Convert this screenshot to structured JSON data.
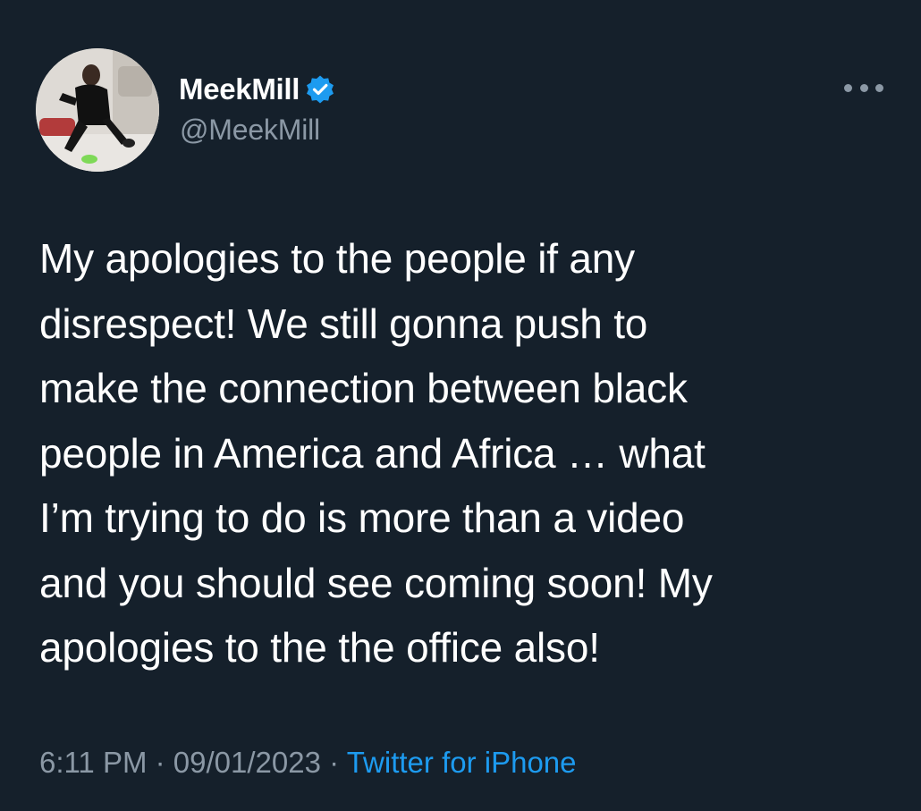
{
  "tweet": {
    "author": {
      "display_name": "MeekMill",
      "handle": "@MeekMill",
      "verified": true,
      "verified_icon": "verified-badge-icon"
    },
    "more_icon": "more-options-icon",
    "text_lines": [
      "My apologies to the people if any",
      "disrespect! We still gonna push to",
      "make the connection between black",
      "people in America and Africa … what",
      "I’m trying to do is more than a video",
      "and you should see coming soon! My",
      "apologies to the the office also!"
    ],
    "time": "6:11 PM",
    "separator": "·",
    "date": "09/01/2023",
    "source": "Twitter for iPhone"
  },
  "colors": {
    "background": "#15202b",
    "primary_text": "#ffffff",
    "secondary_text": "#8b98a5",
    "accent": "#1d9bf0"
  }
}
